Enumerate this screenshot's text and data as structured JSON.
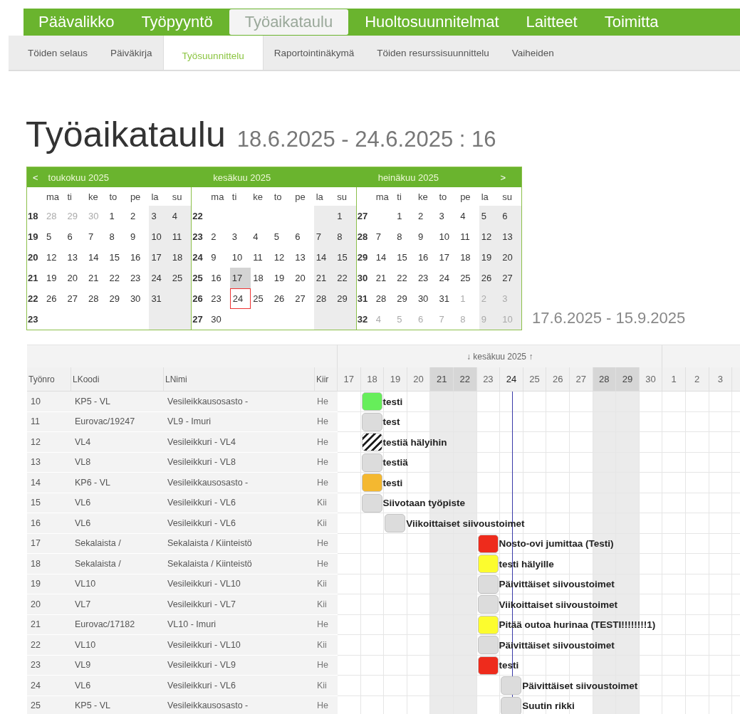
{
  "main_nav": [
    {
      "label": "Päävalikko",
      "selected": false
    },
    {
      "label": "Työpyyntö",
      "selected": false
    },
    {
      "label": "Työaikataulu",
      "selected": true
    },
    {
      "label": "Huoltosuunnitelmat",
      "selected": false
    },
    {
      "label": "Laitteet",
      "selected": false
    },
    {
      "label": "Toimitta",
      "selected": false
    }
  ],
  "sub_nav": [
    {
      "label": "Töiden selaus",
      "selected": false
    },
    {
      "label": "Päiväkirja",
      "selected": false
    },
    {
      "label": "Työsuunnittelu",
      "selected": true
    },
    {
      "label": "Raportointinäkymä",
      "selected": false
    },
    {
      "label": "Töiden resurssisuunnittelu",
      "selected": false
    },
    {
      "label": "Vaiheiden",
      "selected": false
    }
  ],
  "title": "Työaikataulu",
  "period": "18.6.2025 - 24.6.2025 : 16",
  "calendar": {
    "prev": "<",
    "next": ">",
    "range": "17.6.2025 - 15.9.2025",
    "months": [
      {
        "title": "toukokuu 2025",
        "day_names": [
          {
            "label": "ma",
            "weekend": false
          },
          {
            "label": "ti",
            "weekend": false
          },
          {
            "label": "ke",
            "weekend": false
          },
          {
            "label": "to",
            "weekend": false
          },
          {
            "label": "pe",
            "weekend": false
          },
          {
            "label": "la",
            "weekend": true
          },
          {
            "label": "su",
            "weekend": true
          }
        ],
        "weeks": [
          {
            "no": "18",
            "days": [
              {
                "d": "28",
                "kind": "other",
                "selected": false
              },
              {
                "d": "29",
                "kind": "other",
                "selected": false
              },
              {
                "d": "30",
                "kind": "other",
                "selected": false
              },
              {
                "d": "1",
                "kind": "day",
                "selected": false
              },
              {
                "d": "2",
                "kind": "day",
                "selected": false
              },
              {
                "d": "3",
                "kind": "day",
                "selected": false
              },
              {
                "d": "4",
                "kind": "day",
                "selected": false
              }
            ]
          },
          {
            "no": "19",
            "days": [
              {
                "d": "5",
                "kind": "day",
                "selected": false
              },
              {
                "d": "6",
                "kind": "day",
                "selected": false
              },
              {
                "d": "7",
                "kind": "day",
                "selected": false
              },
              {
                "d": "8",
                "kind": "day",
                "selected": false
              },
              {
                "d": "9",
                "kind": "day",
                "selected": false
              },
              {
                "d": "10",
                "kind": "day",
                "selected": false
              },
              {
                "d": "11",
                "kind": "day",
                "selected": false
              }
            ]
          },
          {
            "no": "20",
            "days": [
              {
                "d": "12",
                "kind": "day",
                "selected": false
              },
              {
                "d": "13",
                "kind": "day",
                "selected": false
              },
              {
                "d": "14",
                "kind": "day",
                "selected": false
              },
              {
                "d": "15",
                "kind": "day",
                "selected": false
              },
              {
                "d": "16",
                "kind": "day",
                "selected": false
              },
              {
                "d": "17",
                "kind": "day",
                "selected": false
              },
              {
                "d": "18",
                "kind": "day",
                "selected": false
              }
            ]
          },
          {
            "no": "21",
            "days": [
              {
                "d": "19",
                "kind": "day",
                "selected": false
              },
              {
                "d": "20",
                "kind": "day",
                "selected": false
              },
              {
                "d": "21",
                "kind": "day",
                "selected": false
              },
              {
                "d": "22",
                "kind": "day",
                "selected": false
              },
              {
                "d": "23",
                "kind": "day",
                "selected": false
              },
              {
                "d": "24",
                "kind": "day",
                "selected": false
              },
              {
                "d": "25",
                "kind": "day",
                "selected": false
              }
            ]
          },
          {
            "no": "22",
            "days": [
              {
                "d": "26",
                "kind": "day",
                "selected": false
              },
              {
                "d": "27",
                "kind": "day",
                "selected": false
              },
              {
                "d": "28",
                "kind": "day",
                "selected": false
              },
              {
                "d": "29",
                "kind": "day",
                "selected": false
              },
              {
                "d": "30",
                "kind": "day",
                "selected": false
              },
              {
                "d": "31",
                "kind": "day",
                "selected": false
              },
              {
                "kind": "blank"
              }
            ]
          },
          {
            "no": "23",
            "days": [
              {
                "kind": "blank"
              },
              {
                "kind": "blank"
              },
              {
                "kind": "blank"
              },
              {
                "kind": "blank"
              },
              {
                "kind": "blank"
              },
              {
                "kind": "blank"
              },
              {
                "kind": "blank"
              }
            ]
          }
        ]
      },
      {
        "title": "kesäkuu 2025",
        "day_names": [
          {
            "label": "ma",
            "weekend": false
          },
          {
            "label": "ti",
            "weekend": false
          },
          {
            "label": "ke",
            "weekend": false
          },
          {
            "label": "to",
            "weekend": false
          },
          {
            "label": "pe",
            "weekend": false
          },
          {
            "label": "la",
            "weekend": true
          },
          {
            "label": "su",
            "weekend": true
          }
        ],
        "weeks": [
          {
            "no": "22",
            "days": [
              {
                "kind": "blank"
              },
              {
                "kind": "blank"
              },
              {
                "kind": "blank"
              },
              {
                "kind": "blank"
              },
              {
                "kind": "blank"
              },
              {
                "kind": "blank"
              },
              {
                "d": "1",
                "kind": "day",
                "selected": false
              }
            ]
          },
          {
            "no": "23",
            "days": [
              {
                "d": "2",
                "kind": "day",
                "selected": false
              },
              {
                "d": "3",
                "kind": "day",
                "selected": false
              },
              {
                "d": "4",
                "kind": "day",
                "selected": false
              },
              {
                "d": "5",
                "kind": "day",
                "selected": false
              },
              {
                "d": "6",
                "kind": "day",
                "selected": false
              },
              {
                "d": "7",
                "kind": "day",
                "selected": false
              },
              {
                "d": "8",
                "kind": "day",
                "selected": false
              }
            ]
          },
          {
            "no": "24",
            "days": [
              {
                "d": "9",
                "kind": "day",
                "selected": false
              },
              {
                "d": "10",
                "kind": "day",
                "selected": false
              },
              {
                "d": "11",
                "kind": "day",
                "selected": false
              },
              {
                "d": "12",
                "kind": "day",
                "selected": false
              },
              {
                "d": "13",
                "kind": "day",
                "selected": false
              },
              {
                "d": "14",
                "kind": "day",
                "selected": false
              },
              {
                "d": "15",
                "kind": "day",
                "selected": false
              }
            ]
          },
          {
            "no": "25",
            "days": [
              {
                "d": "16",
                "kind": "day",
                "selected": false
              },
              {
                "d": "17",
                "kind": "today",
                "selected": false
              },
              {
                "d": "18",
                "kind": "day",
                "selected": false
              },
              {
                "d": "19",
                "kind": "day",
                "selected": false
              },
              {
                "d": "20",
                "kind": "day",
                "selected": false
              },
              {
                "d": "21",
                "kind": "day",
                "selected": false
              },
              {
                "d": "22",
                "kind": "day",
                "selected": false
              }
            ]
          },
          {
            "no": "26",
            "days": [
              {
                "d": "23",
                "kind": "day",
                "selected": false
              },
              {
                "d": "24",
                "kind": "day",
                "selected": true
              },
              {
                "d": "25",
                "kind": "day",
                "selected": false
              },
              {
                "d": "26",
                "kind": "day",
                "selected": false
              },
              {
                "d": "27",
                "kind": "day",
                "selected": false
              },
              {
                "d": "28",
                "kind": "day",
                "selected": false
              },
              {
                "d": "29",
                "kind": "day",
                "selected": false
              }
            ]
          },
          {
            "no": "27",
            "days": [
              {
                "d": "30",
                "kind": "day",
                "selected": false
              },
              {
                "kind": "blank"
              },
              {
                "kind": "blank"
              },
              {
                "kind": "blank"
              },
              {
                "kind": "blank"
              },
              {
                "kind": "blank"
              },
              {
                "kind": "blank"
              }
            ]
          }
        ]
      },
      {
        "title": "heinäkuu 2025",
        "day_names": [
          {
            "label": "ma",
            "weekend": false
          },
          {
            "label": "ti",
            "weekend": false
          },
          {
            "label": "ke",
            "weekend": false
          },
          {
            "label": "to",
            "weekend": false
          },
          {
            "label": "pe",
            "weekend": false
          },
          {
            "label": "la",
            "weekend": true
          },
          {
            "label": "su",
            "weekend": true
          }
        ],
        "weeks": [
          {
            "no": "27",
            "days": [
              {
                "kind": "blank"
              },
              {
                "d": "1",
                "kind": "day",
                "selected": false
              },
              {
                "d": "2",
                "kind": "day",
                "selected": false
              },
              {
                "d": "3",
                "kind": "day",
                "selected": false
              },
              {
                "d": "4",
                "kind": "day",
                "selected": false
              },
              {
                "d": "5",
                "kind": "day",
                "selected": false
              },
              {
                "d": "6",
                "kind": "day",
                "selected": false
              }
            ]
          },
          {
            "no": "28",
            "days": [
              {
                "d": "7",
                "kind": "day",
                "selected": false
              },
              {
                "d": "8",
                "kind": "day",
                "selected": false
              },
              {
                "d": "9",
                "kind": "day",
                "selected": false
              },
              {
                "d": "10",
                "kind": "day",
                "selected": false
              },
              {
                "d": "11",
                "kind": "day",
                "selected": false
              },
              {
                "d": "12",
                "kind": "day",
                "selected": false
              },
              {
                "d": "13",
                "kind": "day",
                "selected": false
              }
            ]
          },
          {
            "no": "29",
            "days": [
              {
                "d": "14",
                "kind": "day",
                "selected": false
              },
              {
                "d": "15",
                "kind": "day",
                "selected": false
              },
              {
                "d": "16",
                "kind": "day",
                "selected": false
              },
              {
                "d": "17",
                "kind": "day",
                "selected": false
              },
              {
                "d": "18",
                "kind": "day",
                "selected": false
              },
              {
                "d": "19",
                "kind": "day",
                "selected": false
              },
              {
                "d": "20",
                "kind": "day",
                "selected": false
              }
            ]
          },
          {
            "no": "30",
            "days": [
              {
                "d": "21",
                "kind": "day",
                "selected": false
              },
              {
                "d": "22",
                "kind": "day",
                "selected": false
              },
              {
                "d": "23",
                "kind": "day",
                "selected": false
              },
              {
                "d": "24",
                "kind": "day",
                "selected": false
              },
              {
                "d": "25",
                "kind": "day",
                "selected": false
              },
              {
                "d": "26",
                "kind": "day",
                "selected": false
              },
              {
                "d": "27",
                "kind": "day",
                "selected": false
              }
            ]
          },
          {
            "no": "31",
            "days": [
              {
                "d": "28",
                "kind": "day",
                "selected": false
              },
              {
                "d": "29",
                "kind": "day",
                "selected": false
              },
              {
                "d": "30",
                "kind": "day",
                "selected": false
              },
              {
                "d": "31",
                "kind": "day",
                "selected": false
              },
              {
                "d": "1",
                "kind": "other",
                "selected": false
              },
              {
                "d": "2",
                "kind": "other",
                "selected": false
              },
              {
                "d": "3",
                "kind": "other",
                "selected": false
              }
            ]
          },
          {
            "no": "32",
            "days": [
              {
                "d": "4",
                "kind": "other",
                "selected": false
              },
              {
                "d": "5",
                "kind": "other",
                "selected": false
              },
              {
                "d": "6",
                "kind": "other",
                "selected": false
              },
              {
                "d": "7",
                "kind": "other",
                "selected": false
              },
              {
                "d": "8",
                "kind": "other",
                "selected": false
              },
              {
                "d": "9",
                "kind": "other",
                "selected": false
              },
              {
                "d": "10",
                "kind": "other",
                "selected": false
              }
            ]
          }
        ]
      }
    ]
  },
  "gantt": {
    "columns": [
      "Työnro",
      "LKoodi",
      "LNimi",
      "Kiir"
    ],
    "months": [
      {
        "label": "↓ kesäkuu 2025 ↑",
        "days": [
          {
            "label": "17",
            "weekend": false,
            "today": false
          },
          {
            "label": "18",
            "weekend": false,
            "today": false
          },
          {
            "label": "19",
            "weekend": false,
            "today": false
          },
          {
            "label": "20",
            "weekend": false,
            "today": false
          },
          {
            "label": "21",
            "weekend": true,
            "today": false
          },
          {
            "label": "22",
            "weekend": true,
            "today": false
          },
          {
            "label": "23",
            "weekend": false,
            "today": false
          },
          {
            "label": "24",
            "weekend": false,
            "today": true
          },
          {
            "label": "25",
            "weekend": false,
            "today": false
          },
          {
            "label": "26",
            "weekend": false,
            "today": false
          },
          {
            "label": "27",
            "weekend": false,
            "today": false
          },
          {
            "label": "28",
            "weekend": true,
            "today": false
          },
          {
            "label": "29",
            "weekend": true,
            "today": false
          },
          {
            "label": "30",
            "weekend": false,
            "today": false
          }
        ]
      },
      {
        "days": [
          {
            "label": "1",
            "weekend": false,
            "today": false
          },
          {
            "label": "2",
            "weekend": false,
            "today": false
          },
          {
            "label": "3",
            "weekend": false,
            "today": false
          }
        ]
      }
    ],
    "rows": [
      {
        "nro": "10",
        "lkoodi": "KP5 - VL",
        "lnimi": "Vesileikkausosasto -",
        "kiir": "He",
        "task": {
          "label": "testi",
          "kind": "solid",
          "color": "#66ee5a"
        },
        "timeline": [
          false,
          true,
          false,
          false,
          false,
          false,
          false,
          false,
          false,
          false,
          false,
          false,
          false,
          false,
          false,
          false,
          false
        ]
      },
      {
        "nro": "11",
        "lkoodi": "Eurovac/19247",
        "lnimi": "VL9 - Imuri",
        "kiir": "He",
        "task": {
          "label": "test",
          "kind": "solid",
          "color": "#dcdcdc"
        },
        "timeline": [
          false,
          true,
          false,
          false,
          false,
          false,
          false,
          false,
          false,
          false,
          false,
          false,
          false,
          false,
          false,
          false,
          false
        ]
      },
      {
        "nro": "12",
        "lkoodi": "VL4",
        "lnimi": "Vesileikkuri - VL4",
        "kiir": "He",
        "task": {
          "label": "testiä hälyihin",
          "kind": "hatched"
        },
        "timeline": [
          false,
          true,
          false,
          false,
          false,
          false,
          false,
          false,
          false,
          false,
          false,
          false,
          false,
          false,
          false,
          false,
          false
        ]
      },
      {
        "nro": "13",
        "lkoodi": "VL8",
        "lnimi": "Vesileikkuri - VL8",
        "kiir": "He",
        "task": {
          "label": "testiä",
          "kind": "solid",
          "color": "#dcdcdc"
        },
        "timeline": [
          false,
          true,
          false,
          false,
          false,
          false,
          false,
          false,
          false,
          false,
          false,
          false,
          false,
          false,
          false,
          false,
          false
        ]
      },
      {
        "nro": "14",
        "lkoodi": "KP6 - VL",
        "lnimi": "Vesileikkausosasto -",
        "kiir": "He",
        "task": {
          "label": "testi",
          "kind": "solid",
          "color": "#f4b830"
        },
        "timeline": [
          false,
          true,
          false,
          false,
          false,
          false,
          false,
          false,
          false,
          false,
          false,
          false,
          false,
          false,
          false,
          false,
          false
        ]
      },
      {
        "nro": "15",
        "lkoodi": "VL6",
        "lnimi": "Vesileikkuri - VL6",
        "kiir": "Kii",
        "task": {
          "label": "Siivotaan työpiste",
          "kind": "solid",
          "color": "#dcdcdc"
        },
        "timeline": [
          false,
          true,
          false,
          false,
          false,
          false,
          false,
          false,
          false,
          false,
          false,
          false,
          false,
          false,
          false,
          false,
          false
        ]
      },
      {
        "nro": "16",
        "lkoodi": "VL6",
        "lnimi": "Vesileikkuri - VL6",
        "kiir": "Kii",
        "task": {
          "label": "Viikoittaiset siivoustoimet",
          "kind": "solid",
          "color": "#dcdcdc"
        },
        "timeline": [
          false,
          false,
          true,
          false,
          false,
          false,
          false,
          false,
          false,
          false,
          false,
          false,
          false,
          false,
          false,
          false,
          false
        ]
      },
      {
        "nro": "17",
        "lkoodi": "Sekalaista /",
        "lnimi": "Sekalaista / Kiinteistö",
        "kiir": "He",
        "task": {
          "label": "Nosto-ovi jumittaa (Testi)",
          "kind": "solid",
          "color": "#ee2b1c"
        },
        "timeline": [
          false,
          false,
          false,
          false,
          false,
          false,
          true,
          false,
          false,
          false,
          false,
          false,
          false,
          false,
          false,
          false,
          false
        ]
      },
      {
        "nro": "18",
        "lkoodi": "Sekalaista /",
        "lnimi": "Sekalaista / Kiinteistö",
        "kiir": "He",
        "task": {
          "label": "testi hälyille",
          "kind": "solid",
          "color": "#fcfc2e"
        },
        "timeline": [
          false,
          false,
          false,
          false,
          false,
          false,
          true,
          false,
          false,
          false,
          false,
          false,
          false,
          false,
          false,
          false,
          false
        ]
      },
      {
        "nro": "19",
        "lkoodi": "VL10",
        "lnimi": "Vesileikkuri - VL10",
        "kiir": "Kii",
        "task": {
          "label": "Päivittäiset siivoustoimet",
          "kind": "solid",
          "color": "#dcdcdc"
        },
        "timeline": [
          false,
          false,
          false,
          false,
          false,
          false,
          true,
          false,
          false,
          false,
          false,
          false,
          false,
          false,
          false,
          false,
          false
        ]
      },
      {
        "nro": "20",
        "lkoodi": "VL7",
        "lnimi": "Vesileikkuri - VL7",
        "kiir": "Kii",
        "task": {
          "label": "Viikoittaiset siivoustoimet",
          "kind": "solid",
          "color": "#dcdcdc"
        },
        "timeline": [
          false,
          false,
          false,
          false,
          false,
          false,
          true,
          false,
          false,
          false,
          false,
          false,
          false,
          false,
          false,
          false,
          false
        ]
      },
      {
        "nro": "21",
        "lkoodi": "Eurovac/17182",
        "lnimi": "VL10 - Imuri",
        "kiir": "He",
        "task": {
          "label": "Pitää outoa hurinaa (TESTI!!!!!!!!1)",
          "kind": "solid",
          "color": "#fcfc2e"
        },
        "timeline": [
          false,
          false,
          false,
          false,
          false,
          false,
          true,
          false,
          false,
          false,
          false,
          false,
          false,
          false,
          false,
          false,
          false
        ]
      },
      {
        "nro": "22",
        "lkoodi": "VL10",
        "lnimi": "Vesileikkuri - VL10",
        "kiir": "Kii",
        "task": {
          "label": "Päivittäiset siivoustoimet",
          "kind": "solid",
          "color": "#dcdcdc"
        },
        "timeline": [
          false,
          false,
          false,
          false,
          false,
          false,
          true,
          false,
          false,
          false,
          false,
          false,
          false,
          false,
          false,
          false,
          false
        ]
      },
      {
        "nro": "23",
        "lkoodi": "VL9",
        "lnimi": "Vesileikkuri - VL9",
        "kiir": "He",
        "task": {
          "label": "testi",
          "kind": "solid",
          "color": "#ee2b1c"
        },
        "timeline": [
          false,
          false,
          false,
          false,
          false,
          false,
          true,
          false,
          false,
          false,
          false,
          false,
          false,
          false,
          false,
          false,
          false
        ]
      },
      {
        "nro": "24",
        "lkoodi": "VL6",
        "lnimi": "Vesileikkuri - VL6",
        "kiir": "Kii",
        "task": {
          "label": "Päivittäiset siivoustoimet",
          "kind": "solid",
          "color": "#dcdcdc"
        },
        "timeline": [
          false,
          false,
          false,
          false,
          false,
          false,
          false,
          true,
          false,
          false,
          false,
          false,
          false,
          false,
          false,
          false,
          false
        ]
      },
      {
        "nro": "25",
        "lkoodi": "KP5 - VL",
        "lnimi": "Vesileikkausosasto -",
        "kiir": "He",
        "task": {
          "label": "Suutin rikki",
          "kind": "solid",
          "color": "#dcdcdc"
        },
        "timeline": [
          false,
          false,
          false,
          false,
          false,
          false,
          false,
          true,
          false,
          false,
          false,
          false,
          false,
          false,
          false,
          false,
          false
        ]
      }
    ]
  }
}
